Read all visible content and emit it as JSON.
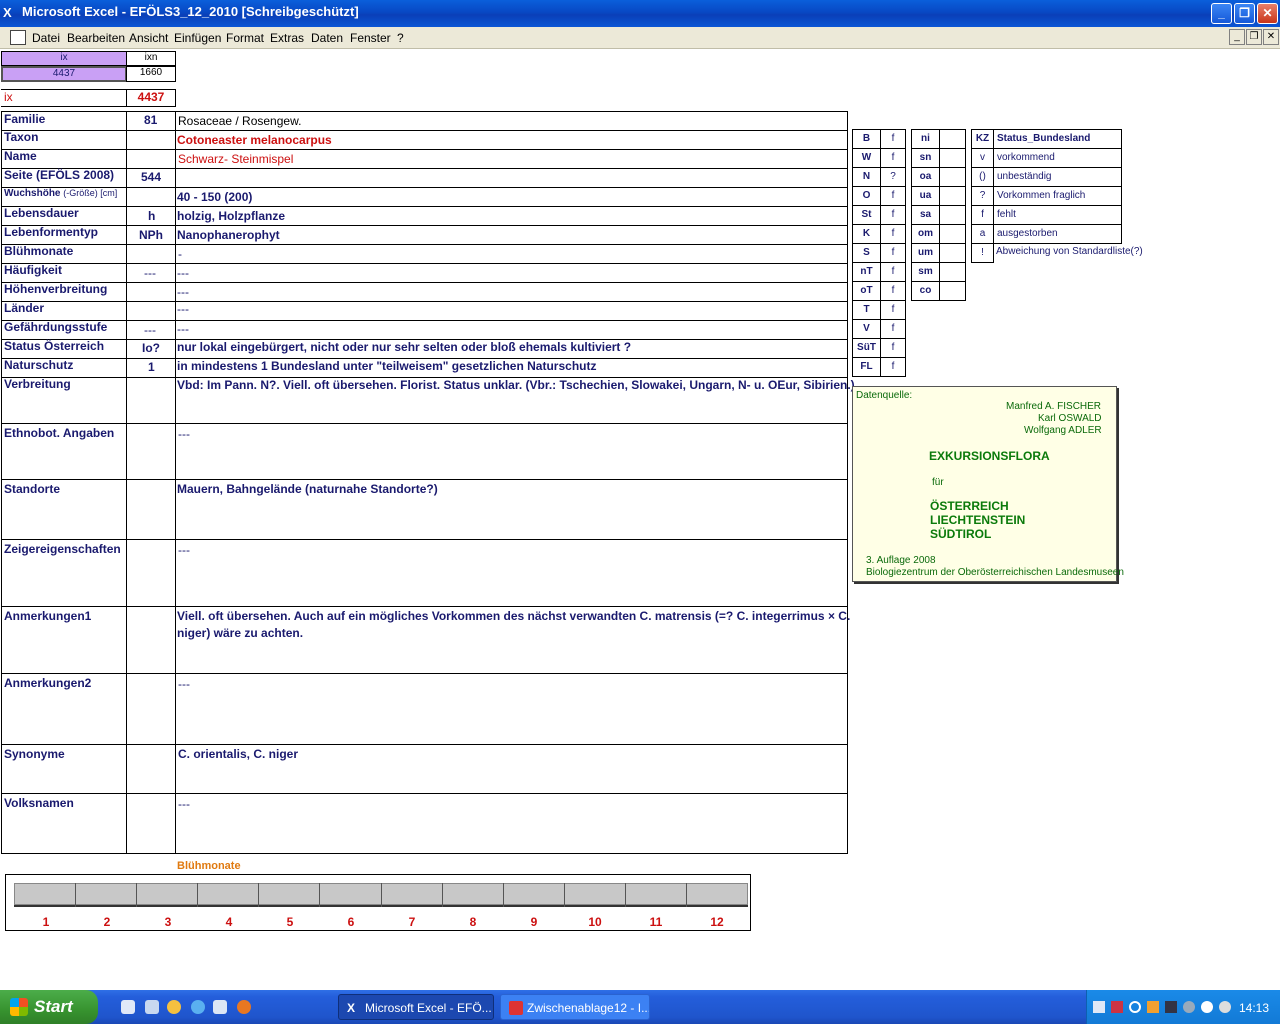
{
  "window": {
    "title": "Microsoft Excel - EFÖLS3_12_2010  [Schreibgeschützt]",
    "min": "_",
    "max": "❐",
    "close": "✕"
  },
  "menu": [
    "Datei",
    "Bearbeiten",
    "Ansicht",
    "Einfügen",
    "Format",
    "Extras",
    "Daten",
    "Fenster",
    "?"
  ],
  "mdi": {
    "min": "_",
    "restore": "❐",
    "close": "✕"
  },
  "top": {
    "ix_head": "ix",
    "ixn_head": "ixn",
    "ix_val": "4437",
    "ixn_val": "1660",
    "ix_label": "ix",
    "ix_big": "4437"
  },
  "rows": [
    {
      "label": "Familie",
      "code": "81",
      "value": "Rosaceae  /  Rosengew."
    },
    {
      "label": "Taxon",
      "code": "",
      "value": "Cotoneaster melanocarpus"
    },
    {
      "label": "Name",
      "code": "",
      "value": "Schwarz- Steinmispel"
    },
    {
      "label": "Seite (EFÖLS 2008)",
      "code": "544",
      "value": ""
    },
    {
      "label": "Wuchshöhe",
      "label_small": "(-Größe) [cm]",
      "code": "",
      "value": " 40 - 150 (200)"
    },
    {
      "label": "Lebensdauer",
      "code": "h",
      "value": "holzig, Holzpflanze"
    },
    {
      "label": "Lebenformentyp",
      "code": "NPh",
      "value": "Nanophanerophyt"
    },
    {
      "label": "Blühmonate",
      "code": "",
      "value": " -"
    },
    {
      "label": "Häufigkeit",
      "code": "---",
      "value": " ---"
    },
    {
      "label": "Höhenverbreitung",
      "code": "",
      "value": " ---"
    },
    {
      "label": "Länder",
      "code": "",
      "value": " ---"
    },
    {
      "label": "Gefährdungsstufe",
      "code": "---",
      "value": "   ---"
    },
    {
      "label": "Status Österreich",
      "code": "Io?",
      "value": "nur lokal eingebürgert, nicht oder nur sehr selten oder bloß ehemals kultiviert ?"
    },
    {
      "label": "Naturschutz",
      "code": "1",
      "value": "in mindestens 1 Bundesland unter \"teilweisem\" gesetzlichen Naturschutz"
    }
  ],
  "big_rows": [
    {
      "label": "Verbreitung",
      "value": "Vbd: Im Pann. N?. Viell. oft übersehen. Florist. Status unklar. (Vbr.: Tschechien, Slowakei, Ungarn, N- u. OEur, Sibirien.)",
      "value2": ""
    },
    {
      "label": "Ethnobot. Angaben",
      "value": "---",
      "value2": ""
    },
    {
      "label": "Standorte",
      "value": "Mauern, Bahngelände (naturnahe Standorte?)",
      "value2": ""
    },
    {
      "label": "Zeigereigenschaften",
      "value": "---",
      "value2": ""
    },
    {
      "label": "Anmerkungen1",
      "value": "Viell. oft übersehen. Auch auf ein mögliches Vorkommen des nächst verwandten C. matrensis (=? C. integerrimus × C.",
      "value2": "niger) wäre zu achten."
    },
    {
      "label": "Anmerkungen2",
      "value": "---",
      "value2": ""
    },
    {
      "label": "Synonyme",
      "value": "C. orientalis, C. niger",
      "value2": ""
    },
    {
      "label": "Volksnamen",
      "value": "---",
      "value2": ""
    }
  ],
  "legend1": [
    {
      "k": "B",
      "v": "f"
    },
    {
      "k": "W",
      "v": "f"
    },
    {
      "k": "N",
      "v": "?"
    },
    {
      "k": "O",
      "v": "f"
    },
    {
      "k": "St",
      "v": "f"
    },
    {
      "k": "K",
      "v": "f"
    },
    {
      "k": "S",
      "v": "f"
    },
    {
      "k": "nT",
      "v": "f"
    },
    {
      "k": "oT",
      "v": "f"
    },
    {
      "k": "T",
      "v": "f"
    },
    {
      "k": "V",
      "v": "f"
    },
    {
      "k": "SüT",
      "v": "f"
    },
    {
      "k": "FL",
      "v": "f"
    }
  ],
  "legend2": [
    {
      "k": "ni"
    },
    {
      "k": "sn"
    },
    {
      "k": "oa"
    },
    {
      "k": "ua"
    },
    {
      "k": "sa"
    },
    {
      "k": "om"
    },
    {
      "k": "um"
    },
    {
      "k": "sm"
    },
    {
      "k": "co"
    }
  ],
  "legend3": {
    "head_k": "KZ",
    "head_v": "Status_Bundesland",
    "items": [
      {
        "k": "v",
        "v": "vorkommend"
      },
      {
        "k": "()",
        "v": "unbeständig"
      },
      {
        "k": "?",
        "v": "Vorkommen fraglich"
      },
      {
        "k": "f",
        "v": "fehlt"
      },
      {
        "k": "a",
        "v": "ausgestorben"
      },
      {
        "k": "!",
        "v": "Abweichung von Standardliste(?)"
      }
    ]
  },
  "source": {
    "label": "Datenquelle:",
    "a1": "Manfred A. FISCHER",
    "a2": "Karl OSWALD",
    "a3": "Wolfgang ADLER",
    "title": "EXKURSIONSFLORA",
    "fuer": "für",
    "c1": "ÖSTERREICH",
    "c2": "LIECHTENSTEIN",
    "c3": "SÜDTIROL",
    "ed": "3. Auflage 2008",
    "pub": "Biologiezentrum der Oberösterreichischen Landesmuseen"
  },
  "months": {
    "title": "Blühmonate",
    "nums": [
      "1",
      "2",
      "3",
      "4",
      "5",
      "6",
      "7",
      "8",
      "9",
      "10",
      "11",
      "12"
    ]
  },
  "taskbar": {
    "start": "Start",
    "task1": "Microsoft Excel - EFÖ...",
    "task2": "Zwischenablage12 - I...",
    "clock": "14:13"
  }
}
